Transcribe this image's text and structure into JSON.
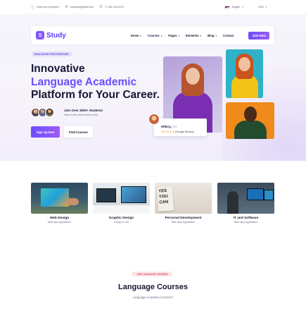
{
  "topbar": {
    "question": "Have any Question?",
    "email": "example@gmail.com",
    "phone": "+1 282 234 4376",
    "language": "English",
    "currency": "USD"
  },
  "navbar": {
    "logo_mark": "S",
    "logo_text": "Study",
    "menu": [
      "Home",
      "Courses",
      "Pages",
      "Elements",
      "Blog",
      "Contact"
    ],
    "join_label": "Join Now"
  },
  "hero": {
    "badge": "EDUCATION FOR EVERYONE",
    "headline_line1": "Innovative",
    "headline_line2": "Language Academic",
    "headline_line3": "Platform for Your Career.",
    "join_title": "Join Over 3000+ Students",
    "join_subtitle": "Have a new ideas every week.",
    "primary_button": "Sign Up Now",
    "secondary_button": "Find Courses",
    "review": {
      "name": "Hillery,",
      "role": "CEO",
      "stars": "★★★★★",
      "text": "(Google Review)"
    }
  },
  "categories": [
    {
      "title": "Web Design",
      "subtitle": "Web App Application"
    },
    {
      "title": "Graphic Design",
      "subtitle": "Design in Art"
    },
    {
      "title": "Personal Development",
      "subtitle": "Web App Application",
      "image_text": "YES YOU CAN"
    },
    {
      "title": "IT and Software",
      "subtitle": "Web App Application"
    }
  ],
  "language_section": {
    "badge": "OUR LANGUAGE COURSES",
    "title": "Language Courses",
    "subtitle": "Language Academy Courses?"
  },
  "colors": {
    "accent": "#6b4dff",
    "accent_end": "#9e5cf5",
    "star": "#f5a623",
    "badge_pink": "#e04663"
  }
}
